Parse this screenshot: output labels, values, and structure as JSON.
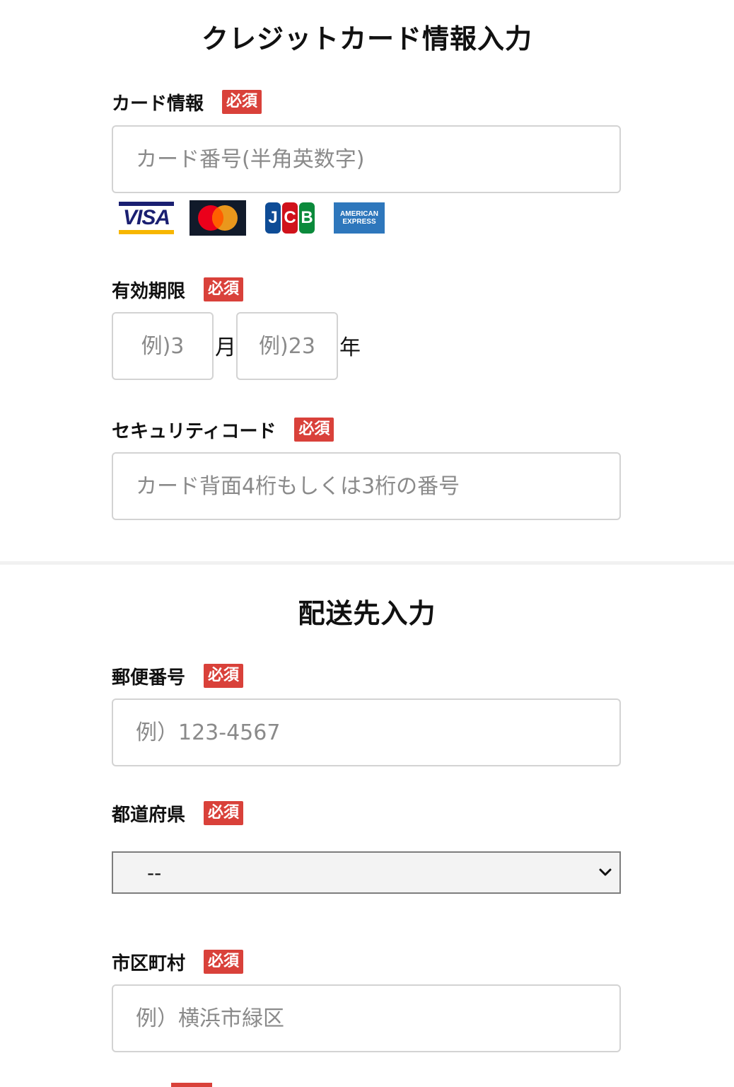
{
  "credit_card_section": {
    "title": "クレジットカード情報入力",
    "card_info": {
      "label": "カード情報",
      "required": "必須",
      "placeholder": "カード番号(半角英数字)"
    },
    "card_brands": [
      "visa-logo",
      "mastercard-logo",
      "jcb-logo",
      "amex-logo"
    ],
    "brand_text": {
      "visa": "VISA",
      "jcb": [
        "J",
        "C",
        "B"
      ],
      "amex_line1": "AMERICAN",
      "amex_line2": "EXPRESS"
    },
    "expiry": {
      "label": "有効期限",
      "required": "必須",
      "month_placeholder": "例)3",
      "month_unit": "月",
      "year_placeholder": "例)23",
      "year_unit": "年"
    },
    "security_code": {
      "label": "セキュリティコード",
      "required": "必須",
      "placeholder": "カード背面4桁もしくは3桁の番号"
    }
  },
  "shipping_section": {
    "title": "配送先入力",
    "postal_code": {
      "label": "郵便番号",
      "required": "必須",
      "placeholder": "例）123-4567"
    },
    "prefecture": {
      "label": "都道府県",
      "required": "必須",
      "selected": "--"
    },
    "city": {
      "label": "市区町村",
      "required": "必須",
      "placeholder": "例）横浜市緑区"
    }
  },
  "colors": {
    "required_badge": "#d9413a",
    "input_border": "#d3d3d3",
    "placeholder": "#8a8a8a",
    "select_bg": "#f3f3f3"
  }
}
